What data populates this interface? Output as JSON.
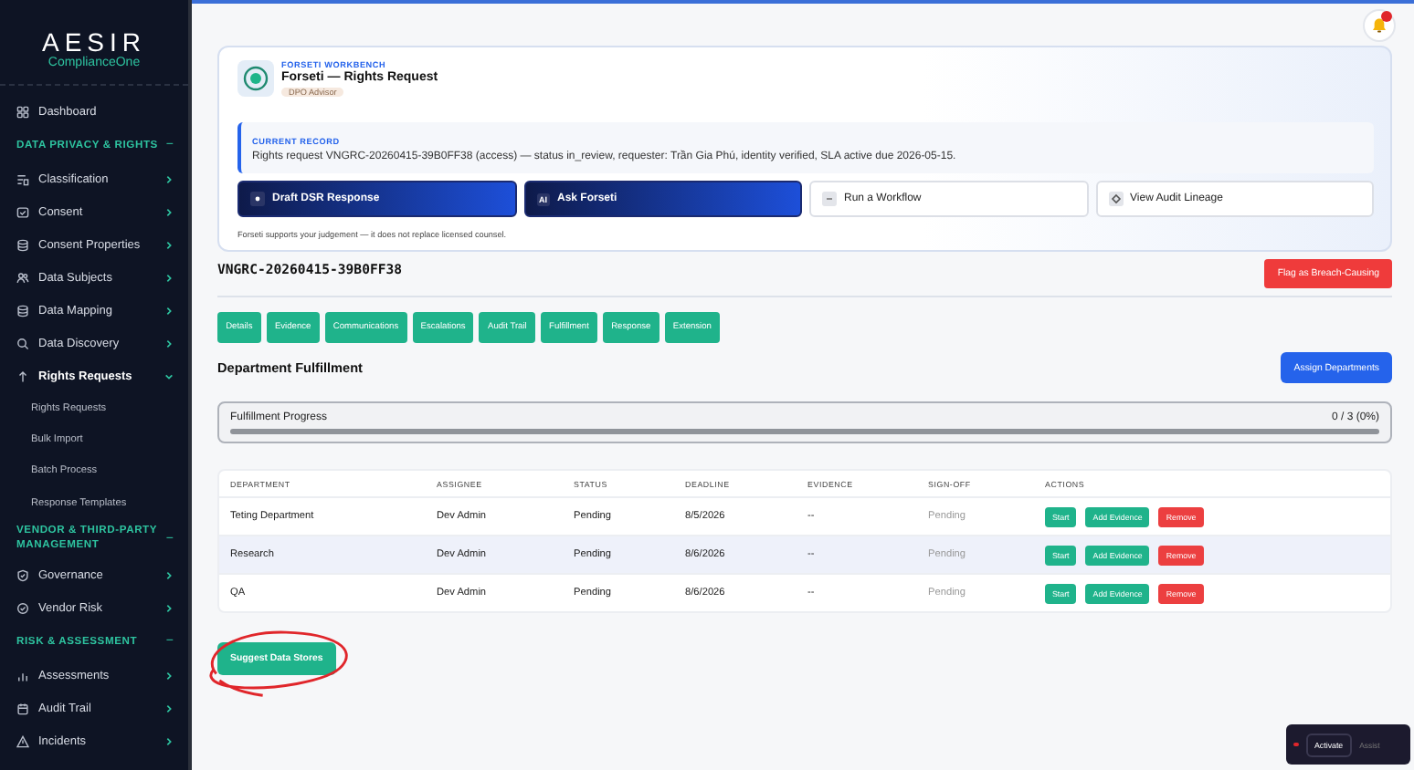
{
  "sidebar": {
    "logo": {
      "title": "AESIR",
      "subtitle": "ComplianceOne"
    },
    "top": [
      {
        "label": "Dashboard",
        "selected": false
      }
    ],
    "sections": [
      {
        "title": "DATA PRIVACY & RIGHTS",
        "toggle": "−",
        "items": [
          {
            "label": "Classification",
            "selected": false,
            "expanded": false
          },
          {
            "label": "Consent",
            "selected": false,
            "expanded": false
          },
          {
            "label": "Consent Properties",
            "selected": false,
            "expanded": false
          },
          {
            "label": "Data Subjects",
            "selected": false,
            "expanded": false
          },
          {
            "label": "Data Mapping",
            "selected": false,
            "expanded": false
          },
          {
            "label": "Data Discovery",
            "selected": false,
            "expanded": false
          },
          {
            "label": "Rights Requests",
            "selected": true,
            "expanded": true,
            "children": [
              {
                "label": "Rights Requests"
              },
              {
                "label": "Bulk Import"
              },
              {
                "label": "Batch Process"
              },
              {
                "label": "Response Templates"
              }
            ]
          }
        ]
      },
      {
        "title": "VENDOR & THIRD-PARTY MANAGEMENT",
        "toggle": "−",
        "items": [
          {
            "label": "Governance",
            "selected": false,
            "expanded": false
          },
          {
            "label": "Vendor Risk",
            "selected": false,
            "expanded": false
          }
        ]
      },
      {
        "title": "RISK & ASSESSMENT",
        "toggle": "−",
        "items": [
          {
            "label": "Assessments",
            "selected": false,
            "expanded": false
          },
          {
            "label": "Audit Trail",
            "selected": false,
            "expanded": false
          },
          {
            "label": "Incidents",
            "selected": false,
            "expanded": false
          }
        ]
      }
    ]
  },
  "workbench": {
    "eyebrow": "FORSETI WORKBENCH",
    "title": "Forseti — Rights Request",
    "badge": "DPO Advisor",
    "record_label": "CURRENT RECORD",
    "record_text": "Rights request VNGRC-20260415-39B0FF38 (access) — status in_review, requester: Trần Gia Phú, identity verified, SLA active due 2026-05-15.",
    "actions": [
      {
        "label": "Draft DSR Response",
        "kind": "primary"
      },
      {
        "label": "Ask Forseti",
        "kind": "primary",
        "badge": "AI"
      },
      {
        "label": "Run a Workflow",
        "kind": "secondary"
      },
      {
        "label": "View Audit Lineage",
        "kind": "secondary"
      }
    ],
    "note": "Forseti supports your judgement — it does not replace licensed counsel."
  },
  "request_id": "VNGRC-20260415-39B0FF38",
  "flag_button": "Flag as Breach-Causing",
  "tabs": [
    "Details",
    "Evidence",
    "Communications",
    "Escalations",
    "Audit Trail",
    "Fulfillment",
    "Response",
    "Extension"
  ],
  "section_title": "Department Fulfillment",
  "assign_button": "Assign Departments",
  "progress": {
    "label": "Fulfillment Progress",
    "reading": "0 / 3 (0%)",
    "level": 0
  },
  "table": {
    "columns": [
      "DEPARTMENT",
      "ASSIGNEE",
      "STATUS",
      "DEADLINE",
      "EVIDENCE",
      "SIGN-OFF",
      "ACTIONS"
    ],
    "rows": [
      {
        "highlighted": false,
        "cells": [
          "Teting Department",
          "Dev Admin",
          "Pending",
          "8/5/2026",
          "--",
          "Pending"
        ],
        "actions": [
          {
            "label": "Start",
            "kind": "go"
          },
          {
            "label": "Add Evidence",
            "kind": "go"
          },
          {
            "label": "Remove",
            "kind": "danger"
          }
        ]
      },
      {
        "highlighted": true,
        "cells": [
          "Research",
          "Dev Admin",
          "Pending",
          "8/6/2026",
          "--",
          "Pending"
        ],
        "actions": [
          {
            "label": "Start",
            "kind": "go"
          },
          {
            "label": "Add Evidence",
            "kind": "go"
          },
          {
            "label": "Remove",
            "kind": "danger"
          }
        ]
      },
      {
        "highlighted": false,
        "cells": [
          "QA",
          "Dev Admin",
          "Pending",
          "8/6/2026",
          "--",
          "Pending"
        ],
        "actions": [
          {
            "label": "Start",
            "kind": "go"
          },
          {
            "label": "Add Evidence",
            "kind": "go"
          },
          {
            "label": "Remove",
            "kind": "danger"
          }
        ]
      }
    ]
  },
  "suggest_button": "Suggest Data Stores",
  "assist": {
    "button": "Activate",
    "label": "Assist"
  }
}
